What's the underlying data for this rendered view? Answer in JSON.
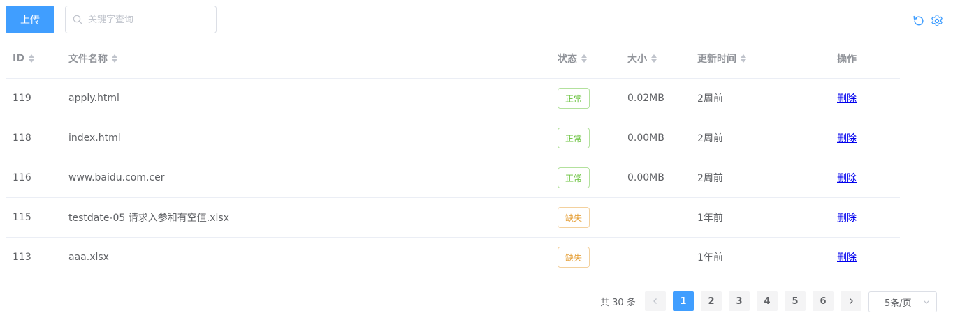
{
  "toolbar": {
    "upload_label": "上传",
    "search_placeholder": "关键字查询",
    "refresh_icon": "refresh-icon",
    "settings_icon": "gear-icon"
  },
  "table": {
    "headers": {
      "id": "ID",
      "name": "文件名称",
      "status": "状态",
      "size": "大小",
      "updated": "更新时间",
      "action": "操作"
    },
    "rows": [
      {
        "id": "119",
        "name": "apply.html",
        "status": "正常",
        "status_type": "ok",
        "size": "0.02MB",
        "updated": "2周前",
        "action": "删除"
      },
      {
        "id": "118",
        "name": "index.html",
        "status": "正常",
        "status_type": "ok",
        "size": "0.00MB",
        "updated": "2周前",
        "action": "删除"
      },
      {
        "id": "116",
        "name": "www.baidu.com.cer",
        "status": "正常",
        "status_type": "ok",
        "size": "0.00MB",
        "updated": "2周前",
        "action": "删除"
      },
      {
        "id": "115",
        "name": "testdate-05 请求入参和有空值.xlsx",
        "status": "缺失",
        "status_type": "miss",
        "size": "",
        "updated": "1年前",
        "action": "删除"
      },
      {
        "id": "113",
        "name": "aaa.xlsx",
        "status": "缺失",
        "status_type": "miss",
        "size": "",
        "updated": "1年前",
        "action": "删除"
      }
    ]
  },
  "pagination": {
    "total_label": "共 30 条",
    "pages": [
      "1",
      "2",
      "3",
      "4",
      "5",
      "6"
    ],
    "current": "1",
    "page_size": "5条/页"
  },
  "colors": {
    "primary": "#409eff",
    "success": "#67c23a",
    "warning": "#e6a23c"
  }
}
